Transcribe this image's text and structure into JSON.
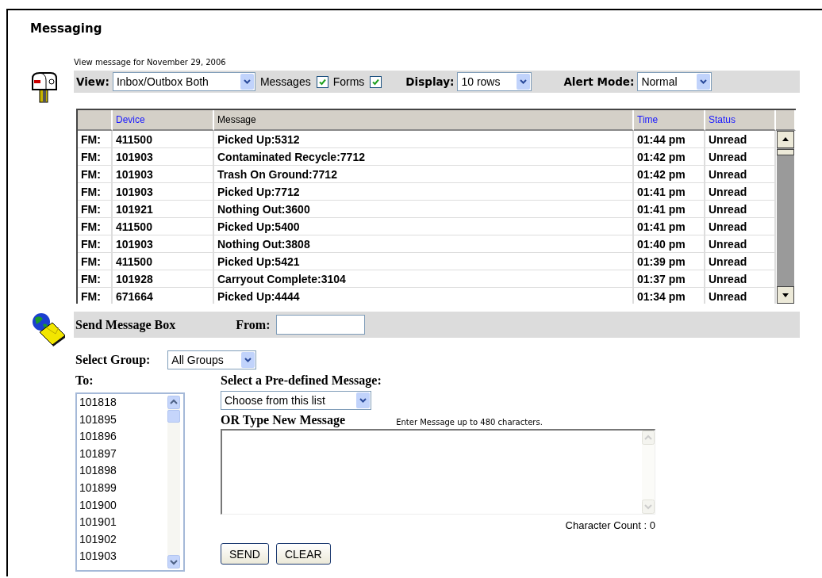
{
  "page": {
    "title": "Messaging",
    "caption": "View message for November 29, 2006"
  },
  "toolbar": {
    "view_label": "View:",
    "view_value": "Inbox/Outbox Both",
    "filters": [
      {
        "label": "Messages",
        "checked": true
      },
      {
        "label": "Forms",
        "checked": true
      }
    ],
    "display_label": "Display:",
    "display_value": "10 rows",
    "alert_label": "Alert Mode:",
    "alert_value": "Normal"
  },
  "table": {
    "columns": [
      "Device",
      "Message",
      "Time",
      "Status"
    ],
    "rows": [
      {
        "prefix": "FM:",
        "device": "411500",
        "message": "Picked Up:5312",
        "time": "01:44 pm",
        "status": "Unread"
      },
      {
        "prefix": "FM:",
        "device": "101903",
        "message": "Contaminated Recycle:7712",
        "time": "01:42 pm",
        "status": "Unread"
      },
      {
        "prefix": "FM:",
        "device": "101903",
        "message": "Trash On Ground:7712",
        "time": "01:42 pm",
        "status": "Unread"
      },
      {
        "prefix": "FM:",
        "device": "101903",
        "message": "Picked Up:7712",
        "time": "01:41 pm",
        "status": "Unread"
      },
      {
        "prefix": "FM:",
        "device": "101921",
        "message": "Nothing Out:3600",
        "time": "01:41 pm",
        "status": "Unread"
      },
      {
        "prefix": "FM:",
        "device": "411500",
        "message": "Picked Up:5400",
        "time": "01:41 pm",
        "status": "Unread"
      },
      {
        "prefix": "FM:",
        "device": "101903",
        "message": "Nothing Out:3808",
        "time": "01:40 pm",
        "status": "Unread"
      },
      {
        "prefix": "FM:",
        "device": "411500",
        "message": "Picked Up:5421",
        "time": "01:39 pm",
        "status": "Unread"
      },
      {
        "prefix": "FM:",
        "device": "101928",
        "message": "Carryout Complete:3104",
        "time": "01:37 pm",
        "status": "Unread"
      },
      {
        "prefix": "FM:",
        "device": "671664",
        "message": "Picked Up:4444",
        "time": "01:34 pm",
        "status": "Unread"
      }
    ]
  },
  "send_box": {
    "title": "Send Message Box",
    "from_label": "From:",
    "group_label": "Select Group:",
    "group_value": "All Groups",
    "to_label": "To:",
    "recipients": [
      "101818",
      "101895",
      "101896",
      "101897",
      "101898",
      "101899",
      "101900",
      "101901",
      "101902",
      "101903"
    ],
    "predefined_label": "Select a Pre-defined Message:",
    "predefined_value": "Choose from this list",
    "new_label": "OR Type New Message",
    "hint": "Enter Message up to 480 characters.",
    "char_count": "Character Count : 0",
    "buttons": [
      "SEND",
      "CLEAR"
    ]
  }
}
